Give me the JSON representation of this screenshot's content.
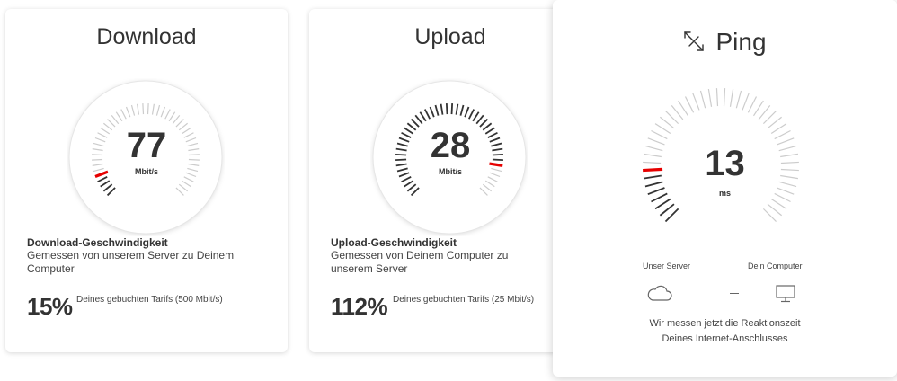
{
  "download": {
    "title": "Download",
    "value": "77",
    "unit": "Mbit/s",
    "progress_fraction": 0.08,
    "info_title": "Download-Geschwindigkeit",
    "info_desc": "Gemessen von unserem Server zu Deinem Computer",
    "percent": "15%",
    "percent_desc": "Deines gebuchten Tarifs (500 Mbit/s)"
  },
  "upload": {
    "title": "Upload",
    "value": "28",
    "unit": "Mbit/s",
    "progress_fraction": 0.87,
    "info_title": "Upload-Geschwindigkeit",
    "info_desc": "Gemessen von Deinem Computer zu unserem Server",
    "percent": "112%",
    "percent_desc": "Deines gebuchten Tarifs (25 Mbit/s)"
  },
  "ping": {
    "title": "Ping",
    "value": "13",
    "unit": "ms",
    "progress_fraction": 0.16,
    "server_label": "Unser Server",
    "computer_label": "Dein Computer",
    "note_line1": "Wir messen jetzt die Reaktionszeit",
    "note_line2": "Deines Internet-Anschlusses"
  },
  "colors": {
    "accent": "#e60000",
    "tick_active": "#333333",
    "tick_inactive": "#cccccc",
    "text": "#333333"
  },
  "icons": {
    "ping": "ping-arrows-icon",
    "server": "cloud-icon",
    "computer": "monitor-icon"
  }
}
